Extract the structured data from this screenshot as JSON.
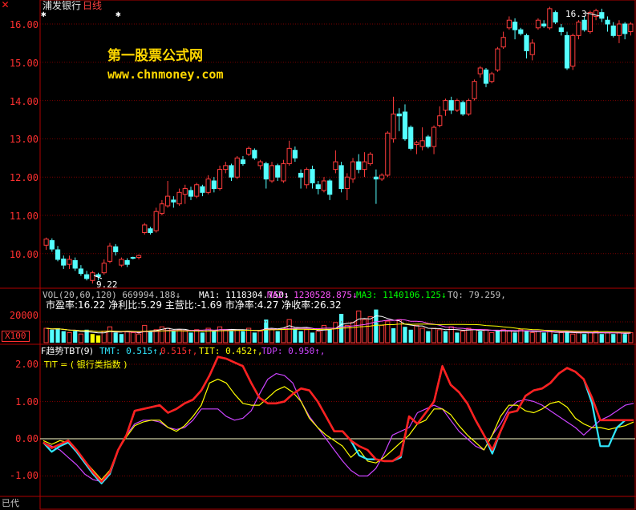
{
  "colors": {
    "up": "#ff3c3c",
    "down": "#54ffff",
    "frame": "#b00000",
    "grid": "#7a0000",
    "ma1": "#ffffff",
    "ma2": "#ff55ff",
    "ma3": "#ffff00",
    "red": "#ff2020",
    "yellow": "#ffff00",
    "magenta": "#cc44ff",
    "cyan": "#30e8ff"
  },
  "header": {
    "stock_name": "浦发银行",
    "period": "日线"
  },
  "watermark": {
    "line1": "第一股票公式网",
    "line2": "www.chnmoney.com"
  },
  "price_panel": {
    "y_ticks": [
      "16.00",
      "15.00",
      "14.00",
      "13.00",
      "12.00",
      "11.00",
      "10.00"
    ],
    "high_label": "16.3",
    "low_label": "9.22",
    "candles": [
      [
        10.22,
        10.38,
        10.1,
        10.42
      ],
      [
        10.34,
        10.12,
        10.05,
        10.4
      ],
      [
        10.1,
        9.85,
        9.8,
        10.2
      ],
      [
        9.86,
        9.7,
        9.6,
        9.95
      ],
      [
        9.72,
        9.85,
        9.6,
        9.95
      ],
      [
        9.82,
        9.62,
        9.55,
        9.9
      ],
      [
        9.6,
        9.48,
        9.42,
        9.7
      ],
      [
        9.45,
        9.35,
        9.3,
        9.55
      ],
      [
        9.3,
        9.5,
        9.22,
        9.55
      ],
      [
        9.45,
        9.4,
        9.3,
        9.5
      ],
      [
        9.5,
        9.75,
        9.45,
        9.85
      ],
      [
        9.8,
        10.2,
        9.75,
        10.28
      ],
      [
        10.18,
        10.05,
        9.95,
        10.25
      ],
      [
        9.7,
        9.85,
        9.65,
        9.9
      ],
      [
        9.82,
        9.72,
        9.65,
        9.88
      ],
      [
        9.9,
        9.88,
        9.85,
        9.92
      ],
      [
        9.9,
        9.95,
        9.85,
        9.98
      ],
      [
        10.55,
        10.75,
        10.5,
        10.8
      ],
      [
        10.65,
        10.55,
        10.5,
        10.7
      ],
      [
        10.6,
        11.1,
        10.55,
        11.2
      ],
      [
        11.05,
        11.3,
        11.0,
        11.4
      ],
      [
        11.25,
        11.5,
        11.2,
        11.9
      ],
      [
        11.4,
        11.35,
        11.2,
        11.5
      ],
      [
        11.3,
        11.6,
        11.25,
        11.7
      ],
      [
        11.55,
        11.7,
        11.3,
        11.8
      ],
      [
        11.65,
        11.5,
        11.4,
        11.75
      ],
      [
        11.5,
        11.8,
        11.45,
        11.85
      ],
      [
        11.75,
        11.6,
        11.5,
        11.8
      ],
      [
        11.6,
        11.95,
        11.55,
        12.05
      ],
      [
        11.9,
        11.7,
        11.6,
        12.0
      ],
      [
        11.7,
        12.2,
        11.65,
        12.3
      ],
      [
        12.2,
        12.3,
        12.1,
        12.4
      ],
      [
        12.3,
        12.0,
        11.9,
        12.35
      ],
      [
        12.0,
        12.5,
        11.95,
        12.55
      ],
      [
        12.45,
        12.35,
        12.3,
        12.55
      ],
      [
        12.6,
        12.75,
        12.55,
        12.8
      ],
      [
        12.7,
        12.5,
        12.45,
        12.75
      ],
      [
        12.3,
        12.4,
        12.2,
        12.45
      ],
      [
        12.35,
        11.95,
        11.7,
        12.4
      ],
      [
        11.9,
        12.3,
        11.85,
        12.4
      ],
      [
        12.3,
        12.0,
        11.9,
        12.35
      ],
      [
        11.9,
        12.35,
        11.85,
        12.45
      ],
      [
        12.35,
        12.75,
        12.3,
        12.95
      ],
      [
        12.7,
        12.5,
        12.4,
        12.8
      ],
      [
        12.1,
        12.0,
        11.7,
        12.2
      ],
      [
        11.8,
        12.2,
        11.7,
        12.25
      ],
      [
        12.2,
        11.85,
        11.7,
        12.3
      ],
      [
        11.8,
        11.7,
        11.55,
        11.9
      ],
      [
        11.65,
        11.9,
        11.6,
        12.0
      ],
      [
        11.9,
        11.55,
        11.4,
        11.95
      ],
      [
        12.2,
        12.4,
        12.1,
        12.7
      ],
      [
        12.3,
        11.7,
        11.6,
        12.4
      ],
      [
        11.7,
        12.0,
        11.4,
        12.1
      ],
      [
        11.95,
        12.4,
        11.85,
        12.5
      ],
      [
        12.4,
        12.2,
        12.1,
        12.6
      ],
      [
        12.2,
        12.4,
        12.0,
        12.65
      ],
      [
        12.35,
        12.6,
        12.3,
        12.65
      ],
      [
        12.0,
        11.95,
        11.3,
        12.2
      ],
      [
        11.95,
        12.05,
        11.9,
        12.1
      ],
      [
        12.05,
        13.15,
        12.0,
        13.2
      ],
      [
        13.0,
        13.65,
        12.9,
        14.1
      ],
      [
        13.65,
        13.6,
        13.2,
        13.8
      ],
      [
        13.7,
        13.0,
        12.95,
        13.9
      ],
      [
        13.3,
        12.75,
        12.7,
        13.35
      ],
      [
        12.85,
        12.9,
        12.6,
        12.95
      ],
      [
        12.8,
        12.95,
        12.7,
        13.3
      ],
      [
        13.05,
        12.8,
        12.75,
        13.1
      ],
      [
        12.8,
        13.3,
        12.6,
        13.35
      ],
      [
        13.35,
        13.6,
        13.3,
        13.85
      ],
      [
        13.75,
        14.0,
        13.6,
        14.05
      ],
      [
        14.0,
        13.75,
        13.65,
        14.1
      ],
      [
        13.75,
        14.0,
        13.7,
        14.05
      ],
      [
        13.95,
        13.65,
        13.6,
        14.0
      ],
      [
        13.65,
        14.0,
        13.6,
        14.05
      ],
      [
        14.05,
        14.5,
        14.0,
        14.55
      ],
      [
        14.7,
        14.85,
        14.6,
        14.9
      ],
      [
        14.8,
        14.45,
        14.35,
        14.85
      ],
      [
        14.5,
        14.7,
        14.45,
        14.75
      ],
      [
        14.8,
        15.35,
        14.75,
        15.4
      ],
      [
        15.4,
        15.65,
        15.35,
        15.8
      ],
      [
        15.9,
        16.1,
        15.85,
        16.2
      ],
      [
        16.05,
        15.85,
        15.6,
        16.15
      ],
      [
        15.85,
        15.75,
        15.7,
        15.9
      ],
      [
        15.7,
        15.3,
        15.1,
        15.75
      ],
      [
        15.2,
        15.5,
        15.05,
        15.6
      ],
      [
        15.9,
        16.1,
        15.85,
        16.15
      ],
      [
        16.0,
        15.95,
        15.9,
        16.1
      ],
      [
        15.9,
        16.4,
        15.85,
        16.45
      ],
      [
        16.3,
        16.05,
        16.0,
        16.35
      ],
      [
        15.9,
        15.8,
        15.7,
        16.0
      ],
      [
        15.7,
        14.85,
        14.8,
        15.8
      ],
      [
        14.9,
        15.7,
        14.8,
        15.75
      ],
      [
        15.7,
        16.05,
        15.6,
        16.1
      ],
      [
        16.1,
        15.85,
        15.8,
        16.2
      ],
      [
        15.8,
        16.3,
        15.75,
        16.35
      ],
      [
        16.2,
        16.35,
        16.1,
        16.4
      ],
      [
        16.3,
        16.15,
        16.05,
        16.4
      ],
      [
        16.1,
        16.0,
        15.8,
        16.2
      ],
      [
        15.95,
        15.7,
        15.65,
        16.05
      ],
      [
        15.7,
        16.0,
        15.5,
        16.1
      ],
      [
        16.0,
        15.75,
        15.6,
        16.05
      ],
      [
        15.8,
        16.0,
        15.7,
        16.05
      ]
    ]
  },
  "volume_panel": {
    "legend": [
      {
        "text": "VOL(20,60,120) 669994.188↓",
        "color": "#c0c0c0"
      },
      {
        "text": "MA1: 1118304.750↓",
        "color": "#ffffff"
      },
      {
        "text": "MA2: 1230528.875↓",
        "color": "#ff55ff"
      },
      {
        "text": "MA3: 1140106.125↓",
        "color": "#00ff00"
      },
      {
        "text": "TQ: 79.259,",
        "color": "#c0c0c0"
      }
    ],
    "info_line": "市盈率:16.22 净利比:5.29 主营比:-1.69 市净率:4.27 净收率:26.32",
    "axis_label": "20000",
    "unit_label": "X100",
    "bars": [
      [
        1,
        1
      ],
      [
        0,
        0.9
      ],
      [
        0,
        1
      ],
      [
        0,
        0.8
      ],
      [
        1,
        0.7
      ],
      [
        0,
        0.8
      ],
      [
        1,
        0.6
      ],
      [
        0,
        0.9
      ],
      [
        2,
        0.6
      ],
      [
        2,
        0.5
      ],
      [
        1,
        0.8
      ],
      [
        1,
        1.1
      ],
      [
        0,
        0.7
      ],
      [
        0,
        0.6
      ],
      [
        1,
        0.8
      ],
      [
        1,
        0.7
      ],
      [
        1,
        0.6
      ],
      [
        1,
        1.2
      ],
      [
        0,
        0.8
      ],
      [
        1,
        0.9
      ],
      [
        1,
        1.1
      ],
      [
        1,
        1.0
      ],
      [
        0,
        0.8
      ],
      [
        1,
        0.9
      ],
      [
        1,
        0.8
      ],
      [
        0,
        0.7
      ],
      [
        1,
        0.9
      ],
      [
        0,
        0.7
      ],
      [
        1,
        1.0
      ],
      [
        0,
        0.8
      ],
      [
        1,
        1.1
      ],
      [
        1,
        0.9
      ],
      [
        0,
        0.8
      ],
      [
        1,
        0.9
      ],
      [
        0,
        0.8
      ],
      [
        1,
        1.0
      ],
      [
        0,
        0.7
      ],
      [
        1,
        0.8
      ],
      [
        0,
        1.6
      ],
      [
        1,
        0.9
      ],
      [
        0,
        0.8
      ],
      [
        1,
        1.0
      ],
      [
        1,
        1.6
      ],
      [
        0,
        1.0
      ],
      [
        0,
        0.8
      ],
      [
        1,
        0.9
      ],
      [
        0,
        0.7
      ],
      [
        1,
        0.8
      ],
      [
        1,
        1.2
      ],
      [
        0,
        0.9
      ],
      [
        1,
        1.4
      ],
      [
        0,
        2.0
      ],
      [
        1,
        1.2
      ],
      [
        1,
        1.4
      ],
      [
        1,
        2.2
      ],
      [
        1,
        1.6
      ],
      [
        1,
        1.8
      ],
      [
        0,
        2.3
      ],
      [
        1,
        1.2
      ],
      [
        1,
        1.5
      ],
      [
        0,
        1.0
      ],
      [
        1,
        1.6
      ],
      [
        0,
        1.1
      ],
      [
        0,
        0.9
      ],
      [
        1,
        1.2
      ],
      [
        1,
        1.0
      ],
      [
        0,
        0.8
      ],
      [
        1,
        1.0
      ],
      [
        1,
        0.9
      ],
      [
        0,
        0.8
      ],
      [
        1,
        1.1
      ],
      [
        0,
        0.7
      ],
      [
        1,
        0.8
      ],
      [
        1,
        1.0
      ],
      [
        1,
        0.9
      ],
      [
        0,
        0.8
      ],
      [
        1,
        0.9
      ],
      [
        1,
        0.7
      ],
      [
        0,
        0.8
      ],
      [
        1,
        0.9
      ],
      [
        1,
        0.8
      ],
      [
        0,
        0.7
      ],
      [
        1,
        0.9
      ],
      [
        0,
        0.8
      ],
      [
        1,
        0.7
      ],
      [
        1,
        0.8
      ],
      [
        0,
        0.7
      ],
      [
        1,
        0.8
      ],
      [
        0,
        0.6
      ],
      [
        1,
        0.7
      ],
      [
        0,
        0.8
      ],
      [
        1,
        0.6
      ],
      [
        1,
        0.7
      ],
      [
        0,
        0.6
      ],
      [
        1,
        0.7
      ],
      [
        1,
        0.8
      ],
      [
        0,
        0.6
      ],
      [
        1,
        0.7
      ],
      [
        0,
        0.6
      ],
      [
        1,
        0.7
      ],
      [
        0,
        0.6
      ],
      [
        1,
        0.7
      ]
    ]
  },
  "indicator_panel": {
    "legend": [
      {
        "text": "F趋势TBT(9)",
        "color": "#ffffff"
      },
      {
        "text": "TMT: 0.515↑,",
        "color": "#30e8ff"
      },
      {
        "text": "0.515↑,",
        "color": "#ff3030"
      },
      {
        "text": "TIT: 0.452↑,",
        "color": "#ffff00"
      },
      {
        "text": "TDP: 0.950↑,",
        "color": "#cc44ff"
      }
    ],
    "subtitle": "TIT = ( 银行类指数 )",
    "y_ticks": [
      "2.00",
      "1.00",
      "0.00",
      "-1.00"
    ],
    "line_red": [
      -0.1,
      -0.25,
      -0.15,
      -0.05,
      -0.3,
      -0.6,
      -0.9,
      -1.15,
      -0.9,
      -0.3,
      0.1,
      0.75,
      0.8,
      0.85,
      0.9,
      0.7,
      0.8,
      0.95,
      1.05,
      1.3,
      1.7,
      2.2,
      2.15,
      2.05,
      1.95,
      1.5,
      1.1,
      0.95,
      0.95,
      1.0,
      1.2,
      1.35,
      1.3,
      1.0,
      0.6,
      0.2,
      0.2,
      -0.05,
      -0.2,
      -0.3,
      -0.55,
      -0.6,
      -0.6,
      -0.45,
      0.6,
      0.4,
      0.7,
      1.0,
      1.95,
      1.45,
      1.25,
      0.95,
      0.5,
      0.1,
      -0.3,
      0.2,
      0.7,
      0.75,
      1.15,
      1.3,
      1.35,
      1.5,
      1.75,
      1.9,
      1.8,
      1.6,
      1.1,
      0.5,
      0.5,
      0.5,
      0.5,
      0.5
    ],
    "line_cyan": [
      -0.1,
      -0.35,
      -0.2,
      -0.1,
      -0.35,
      -0.65,
      -0.95,
      -1.2,
      -0.95,
      -0.3,
      0.1,
      0.75,
      0.8,
      0.85,
      0.9,
      0.7,
      0.8,
      0.95,
      1.05,
      1.3,
      1.7,
      2.2,
      2.15,
      2.05,
      1.95,
      1.5,
      1.1,
      0.95,
      0.95,
      1.0,
      1.2,
      1.35,
      1.3,
      1.0,
      0.6,
      0.2,
      0.2,
      -0.05,
      -0.45,
      -0.55,
      -0.55,
      -0.6,
      -0.6,
      -0.5,
      0.6,
      0.4,
      0.7,
      1.0,
      1.95,
      1.45,
      1.25,
      0.95,
      0.5,
      0.1,
      -0.4,
      0.2,
      0.7,
      0.75,
      1.15,
      1.3,
      1.35,
      1.5,
      1.75,
      1.9,
      1.8,
      1.6,
      0.95,
      -0.2,
      -0.2,
      0.3,
      0.5,
      0.5
    ],
    "line_yellow": [
      -0.05,
      -0.15,
      -0.05,
      -0.1,
      -0.35,
      -0.6,
      -0.85,
      -1.1,
      -0.85,
      -0.3,
      0.05,
      0.35,
      0.45,
      0.5,
      0.5,
      0.3,
      0.2,
      0.35,
      0.6,
      0.9,
      1.5,
      1.6,
      1.5,
      1.2,
      0.95,
      0.9,
      0.9,
      1.1,
      1.3,
      1.4,
      1.25,
      1.0,
      0.55,
      0.3,
      0.1,
      -0.05,
      -0.2,
      -0.5,
      -0.3,
      -0.6,
      -0.65,
      -0.5,
      -0.3,
      -0.1,
      0.1,
      0.4,
      0.5,
      0.8,
      0.8,
      0.65,
      0.35,
      0.1,
      -0.1,
      -0.3,
      0.1,
      0.6,
      0.9,
      0.9,
      0.75,
      0.7,
      0.8,
      0.95,
      1.0,
      0.85,
      0.55,
      0.4,
      0.3,
      0.3,
      0.25,
      0.3,
      0.35,
      0.45
    ],
    "line_magenta": [
      -0.1,
      -0.2,
      -0.3,
      -0.5,
      -0.7,
      -0.95,
      -1.1,
      -1.15,
      -0.9,
      -0.3,
      0.1,
      0.4,
      0.5,
      0.5,
      0.45,
      0.3,
      0.25,
      0.3,
      0.5,
      0.8,
      0.8,
      0.8,
      0.6,
      0.5,
      0.55,
      0.75,
      1.2,
      1.6,
      1.75,
      1.7,
      1.5,
      1.0,
      0.6,
      0.3,
      0.0,
      -0.3,
      -0.6,
      -0.85,
      -1.0,
      -1.0,
      -0.8,
      -0.4,
      0.1,
      0.2,
      0.3,
      0.7,
      0.8,
      0.9,
      0.8,
      0.5,
      0.2,
      0.0,
      -0.2,
      -0.3,
      0.1,
      0.4,
      0.8,
      1.0,
      1.05,
      1.0,
      0.9,
      0.75,
      0.6,
      0.45,
      0.3,
      0.1,
      0.3,
      0.5,
      0.6,
      0.75,
      0.9,
      0.95
    ]
  },
  "bottom_bar": {
    "left_label": "已代"
  }
}
